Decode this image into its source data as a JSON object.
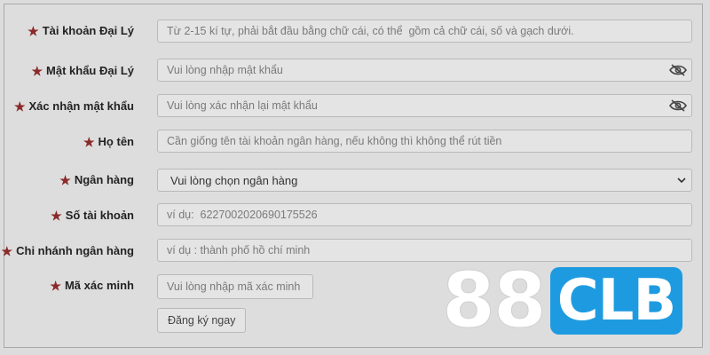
{
  "form": {
    "fields": [
      {
        "label": "Tài khoản Đại Lý",
        "placeholder": "Từ 2-15 kí tự, phải bắt đầu bằng chữ cái, có thể  gồm cả chữ cái, số và gạch dưới."
      },
      {
        "label": "Mật khẩu Đại Lý",
        "placeholder": "Vui lòng nhập mật khẩu"
      },
      {
        "label": "Xác nhận mật khẩu",
        "placeholder": "Vui lòng xác nhận lại mật khẩu"
      },
      {
        "label": "Họ tên",
        "placeholder": "Cần giống tên tài khoản ngân hàng, nếu không thì không thể rút tiền"
      },
      {
        "label": "Ngân hàng",
        "selected": "Vui lòng chọn ngân hàng"
      },
      {
        "label": "Số tài khoản",
        "placeholder": "ví dụ:  6227002020690175526"
      },
      {
        "label": "Chi nhánh ngân hàng",
        "placeholder": "ví dụ : thành phố hồ chí minh"
      },
      {
        "label": "Mã xác minh",
        "placeholder": "Vui lòng nhập mã xác minh"
      }
    ],
    "required_mark": "★",
    "submit_label": "Đăng ký ngay"
  },
  "logo": {
    "number": "88",
    "text": "CLB",
    "brand_color": "#1e9be0"
  },
  "icons": {
    "password_toggle": "eye-slash-icon",
    "select_arrow": "chevron-down-icon"
  }
}
